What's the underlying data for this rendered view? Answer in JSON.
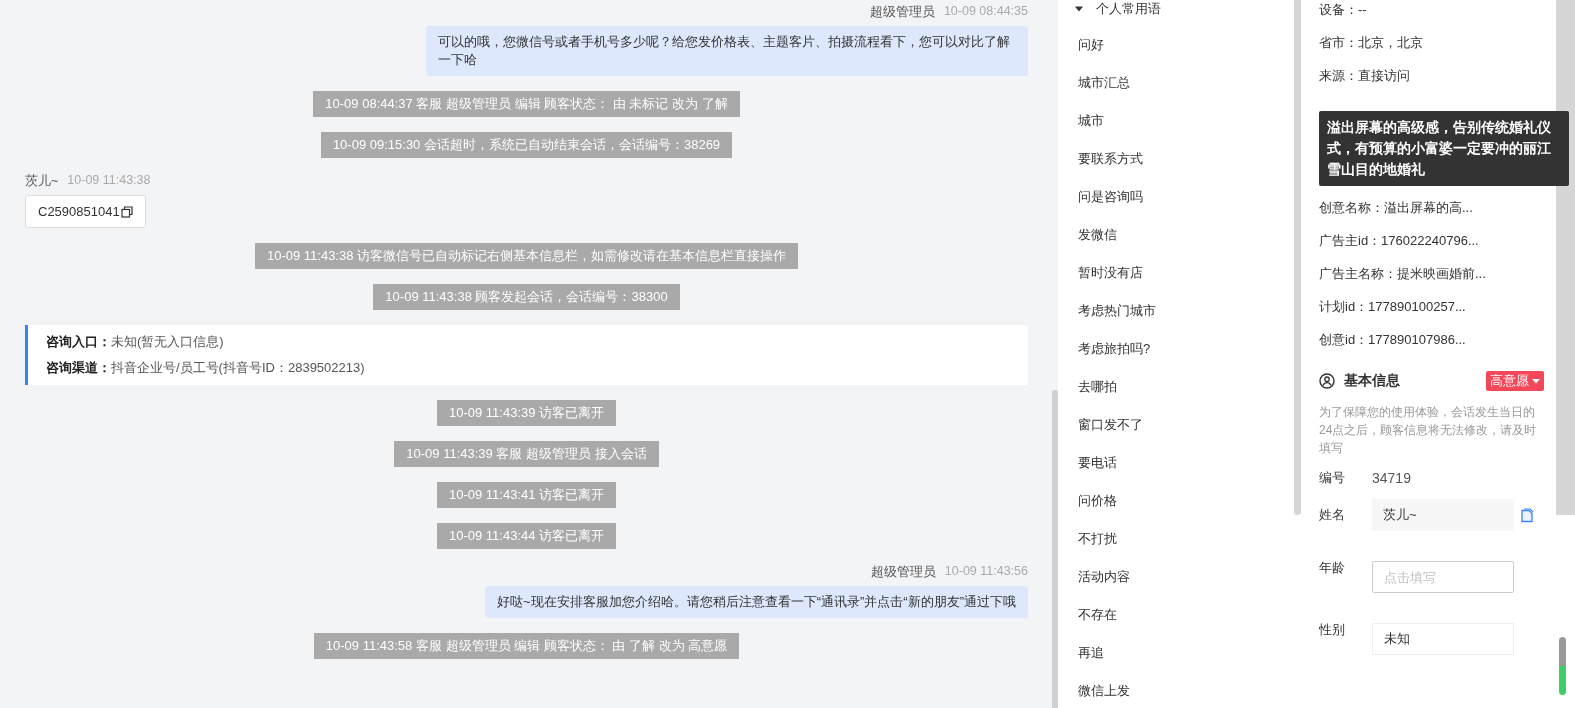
{
  "chat": {
    "messages": [
      {
        "kind": "agent",
        "sender": "超级管理员",
        "time": "10-09 08:44:35",
        "text": "可以的哦，您微信号或者手机号多少呢？给您发价格表、主题客片、拍摄流程看下，您可以对比了解一下哈"
      },
      {
        "kind": "system",
        "text": "10-09 08:44:37 客服 超级管理员 编辑 顾客状态： 由 未标记 改为 了解"
      },
      {
        "kind": "system",
        "text": "10-09 09:15:30 会话超时，系统已自动结束会话，会话编号：38269"
      },
      {
        "kind": "visitor",
        "sender": "茨儿~",
        "time": "10-09 11:43:38",
        "text": "C2590851041"
      },
      {
        "kind": "system",
        "text": "10-09 11:43:38 访客微信号已自动标记右侧基本信息栏，如需修改请在基本信息栏直接操作"
      },
      {
        "kind": "system",
        "text": "10-09 11:43:38 顾客发起会话，会话编号：38300"
      },
      {
        "kind": "entry",
        "lines": [
          {
            "label": "咨询入口：",
            "value": "未知(暂无入口信息)"
          },
          {
            "label": "咨询渠道：",
            "value": "抖音企业号/员工号(抖音号ID：2839502213)"
          }
        ]
      },
      {
        "kind": "system",
        "text": "10-09 11:43:39 访客已离开"
      },
      {
        "kind": "system",
        "text": "10-09 11:43:39 客服 超级管理员 接入会话"
      },
      {
        "kind": "system",
        "text": "10-09 11:43:41 访客已离开"
      },
      {
        "kind": "system",
        "text": "10-09 11:43:44 访客已离开"
      },
      {
        "kind": "agent",
        "sender": "超级管理员",
        "time": "10-09 11:43:56",
        "text": "好哒~现在安排客服加您介绍哈。请您稍后注意查看一下“通讯录”并点击“新的朋友”通过下哦"
      },
      {
        "kind": "system",
        "text": "10-09 11:43:58 客服 超级管理员 编辑 顾客状态： 由 了解 改为 高意愿"
      }
    ]
  },
  "phrases": {
    "group": "个人常用语",
    "expanded": true,
    "items": [
      "问好",
      "城市汇总",
      "城市",
      "要联系方式",
      "问是咨询吗",
      "发微信",
      "暂时没有店",
      "考虑热门城市",
      "考虑旅拍吗?",
      "去哪拍",
      "窗口发不了",
      "要电话",
      "问价格",
      "不打扰",
      "活动内容",
      "不存在",
      "再追",
      "微信上发"
    ]
  },
  "visit_info": {
    "rows_above": [
      "设备：--",
      "省市：北京，北京",
      "来源：直接访问"
    ],
    "tooltip": "溢出屏幕的高级感，告别传统婚礼仪式，有预算的小富婆一定要冲的丽江雪山目的地婚礼",
    "rows_below": [
      "创意名称：溢出屏幕的高...",
      "广告主id：176022240796...",
      "广告主名称：提米映画婚前...",
      "计划id：177890100257...",
      "创意id：177890107986..."
    ]
  },
  "basic_info": {
    "title": "基本信息",
    "status": "高意愿",
    "note": "为了保障您的使用体验，会话发生当日的24点之后，顾客信息将无法修改，请及时填写",
    "fields": [
      {
        "kind": "text",
        "label": "编号",
        "value": "34719"
      },
      {
        "kind": "filled",
        "label": "姓名",
        "value": "茨儿~"
      },
      {
        "kind": "input",
        "label": "年龄",
        "placeholder": "点击填写"
      },
      {
        "kind": "select",
        "label": "性别",
        "value": "未知"
      }
    ]
  }
}
